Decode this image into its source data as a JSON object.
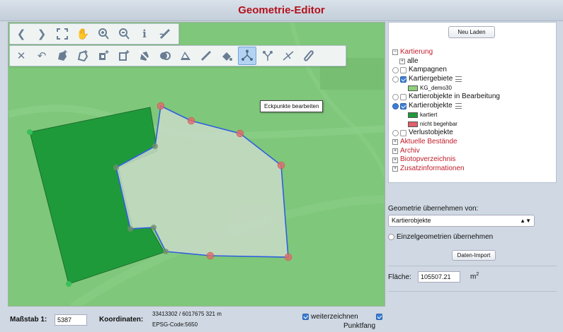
{
  "window": {
    "title": "Geometrie-Editor"
  },
  "toolbar": {
    "row1": [
      "back-arrow-icon",
      "forward-arrow-icon",
      "fullscreen-icon",
      "pan-hand-icon",
      "zoom-in-icon",
      "zoom-out-icon",
      "info-icon",
      "measure-icon"
    ],
    "row2": [
      "delete-icon",
      "undo-icon",
      "add-polygon-icon",
      "add-ring-icon",
      "add-part-icon",
      "split-icon",
      "remove-icon",
      "merge-icon",
      "buffer-icon",
      "ruler-icon",
      "paint-icon",
      "edit-vertices-icon",
      "move-vertex-icon",
      "split-line-icon",
      "line-tool-icon"
    ],
    "active": "edit-vertices-icon"
  },
  "tooltip": "Eckpunkte bearbeiten",
  "panel": {
    "reload_label": "Neu Laden",
    "tree": {
      "kartierung": "Kartierung",
      "alle": "alle",
      "kampagnen": "Kampagnen",
      "kartiergebiete": "Kartiergebiete",
      "kg_demo": "KG_demo30",
      "in_bearbeitung": "Kartierobjekte in Bearbeitung",
      "kartierobjekte": "Kartierobjekte",
      "kartiert": "kartiert",
      "nicht_begehbar": "nicht begehbar",
      "verlustobjekte": "Verlustobjekte",
      "aktuelle_bestaende": "Aktuelle Bestände",
      "archiv": "Archiv",
      "biotopverzeichnis": "Biotopverzeichnis",
      "zusatzinformationen": "Zusatzinformationen"
    },
    "colors": {
      "kg_demo": "#8fd07a",
      "kartiert": "#1d9a3a",
      "nicht_begehbar": "#e0606b"
    }
  },
  "geometry": {
    "label": "Geometrie übernehmen von:",
    "select_value": "Kartierobjekte",
    "single_label": "Einzelgeometrien übernehmen",
    "import_label": "Daten-Import",
    "area_label": "Fläche:",
    "area_value": "105507.21",
    "area_unit": "m",
    "area_unit_exp": "2"
  },
  "status": {
    "scale_label": "Maßstab 1:",
    "scale_value": "5387",
    "coord_label": "Koordinaten:",
    "coord_value": "33413302 / 6017675  321 m",
    "epsg": "EPSG-Code:5650",
    "continue_label": "weiterzeichnen",
    "snap_label": "Punktfang"
  }
}
